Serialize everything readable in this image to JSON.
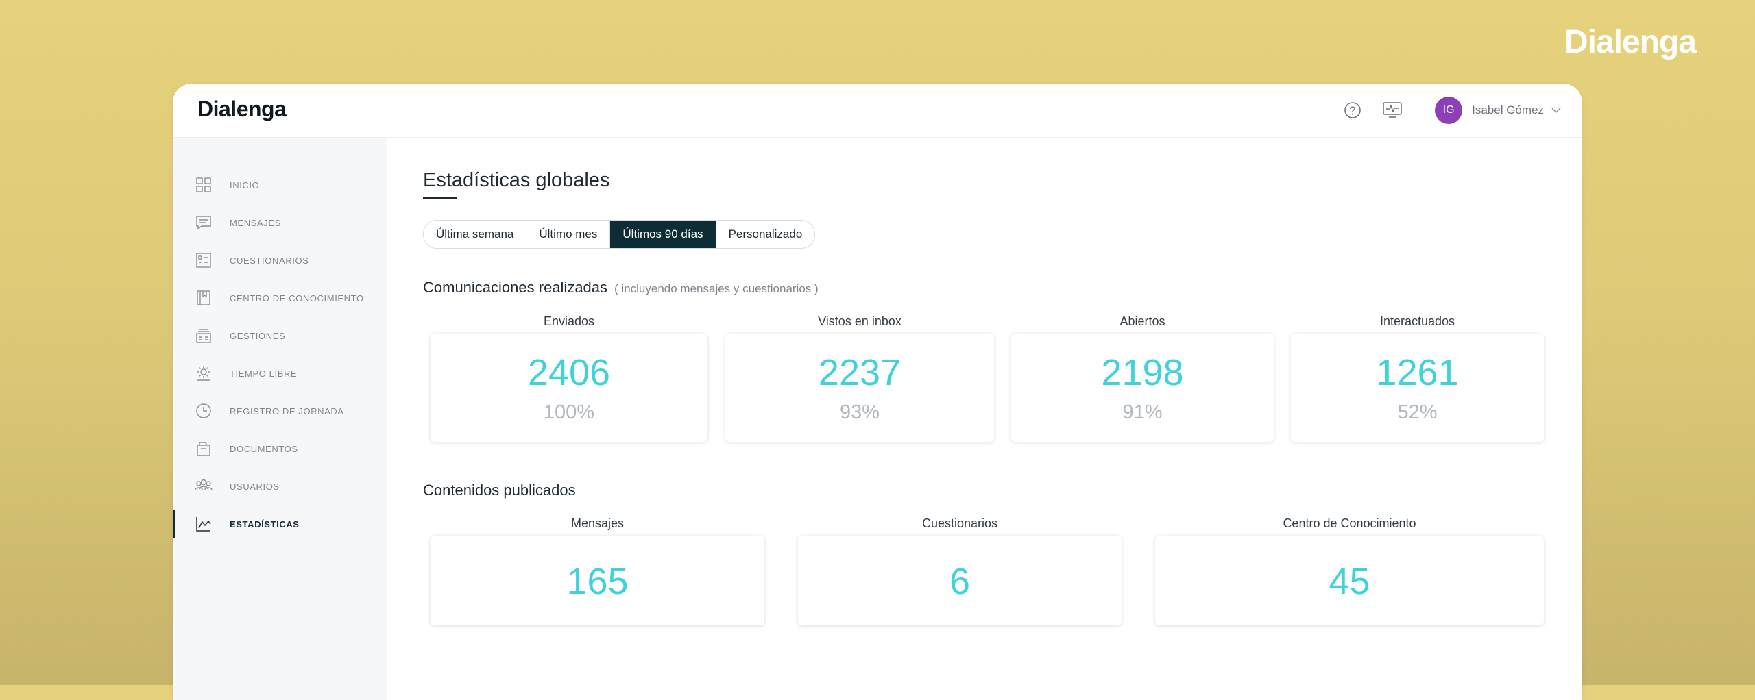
{
  "brand": "Dialenga",
  "header": {
    "logo": "Dialenga",
    "user": {
      "initials": "IG",
      "name": "Isabel Gómez"
    },
    "icons": [
      "help-icon",
      "monitor-activity-icon",
      "chevron-down-icon"
    ]
  },
  "sidebar": {
    "items": [
      {
        "label": "INICIO",
        "icon": "grid-icon",
        "active": false
      },
      {
        "label": "MENSAJES",
        "icon": "message-icon",
        "active": false
      },
      {
        "label": "CUESTIONARIOS",
        "icon": "form-icon",
        "active": false
      },
      {
        "label": "CENTRO DE CONOCIMIENTO",
        "icon": "book-icon",
        "active": false
      },
      {
        "label": "GESTIONES",
        "icon": "inbox-icon",
        "active": false
      },
      {
        "label": "TIEMPO LIBRE",
        "icon": "sun-icon",
        "active": false
      },
      {
        "label": "REGISTRO DE JORNADA",
        "icon": "clock-icon",
        "active": false
      },
      {
        "label": "DOCUMENTOS",
        "icon": "document-icon",
        "active": false
      },
      {
        "label": "USUARIOS",
        "icon": "users-icon",
        "active": false
      },
      {
        "label": "ESTADÍSTICAS",
        "icon": "chart-icon",
        "active": true
      }
    ]
  },
  "main": {
    "title": "Estadísticas globales",
    "ranges": [
      {
        "label": "Última semana",
        "active": false
      },
      {
        "label": "Último mes",
        "active": false
      },
      {
        "label": "Últimos 90 días",
        "active": true
      },
      {
        "label": "Personalizado",
        "active": false
      }
    ],
    "communications": {
      "title": "Comunicaciones realizadas",
      "note": "( incluyendo mensajes y cuestionarios )",
      "stats": [
        {
          "label": "Enviados",
          "value": "2406",
          "pct": "100%"
        },
        {
          "label": "Vistos en inbox",
          "value": "2237",
          "pct": "93%"
        },
        {
          "label": "Abiertos",
          "value": "2198",
          "pct": "91%"
        },
        {
          "label": "Interactuados",
          "value": "1261",
          "pct": "52%"
        }
      ]
    },
    "contents": {
      "title": "Contenidos publicados",
      "stats": [
        {
          "label": "Mensajes",
          "value": "165"
        },
        {
          "label": "Cuestionarios",
          "value": "6"
        },
        {
          "label": "Centro de Conocimiento",
          "value": "45"
        }
      ]
    }
  },
  "colors": {
    "accent": "#3fd3d9",
    "dark": "#0e2c35",
    "avatar": "#8d3fb5",
    "background": "#e6d27c"
  }
}
